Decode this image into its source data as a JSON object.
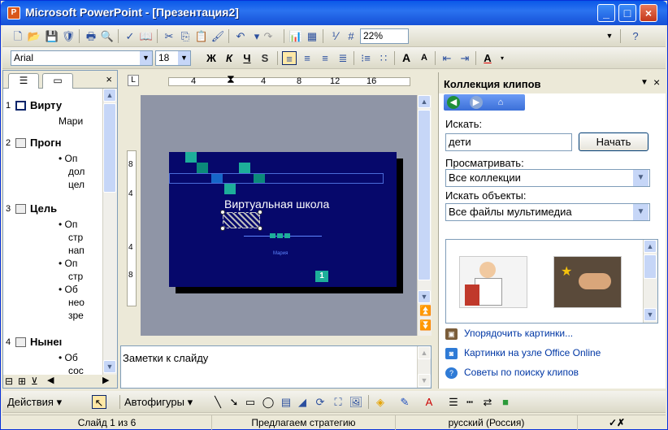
{
  "window": {
    "title": "Microsoft PowerPoint - [Презентация2]",
    "controls": [
      "minimize",
      "maximize",
      "close"
    ]
  },
  "standard_toolbar": {
    "zoom": "22%"
  },
  "format_toolbar": {
    "font": "Arial",
    "size": "18",
    "bold": "Ж",
    "italic": "К",
    "underline": "Ч",
    "shadow": "S",
    "grow_font": "A",
    "shrink_font": "A",
    "font_color": "A"
  },
  "outline": {
    "slides": [
      {
        "num": "1",
        "title": "Вирту",
        "lines": [
          "Мари"
        ]
      },
      {
        "num": "2",
        "title": "Прогн",
        "lines": [
          "• Оп",
          "дол",
          "цел"
        ]
      },
      {
        "num": "3",
        "title": "Цель",
        "lines": [
          "• Оп",
          "стр",
          "нап",
          "• Оп",
          "стр",
          "• Об",
          "нео",
          "зре"
        ]
      },
      {
        "num": "4",
        "title": "Нынеı",
        "lines": [
          "• Об",
          "сос"
        ]
      }
    ]
  },
  "ruler": {
    "top": [
      "4",
      "4",
      "8",
      "12",
      "16"
    ],
    "left": [
      "8",
      "4",
      "4",
      "8"
    ]
  },
  "slide": {
    "title": "Виртуальная школа",
    "subtitle": "Мария",
    "number": "1",
    "colors": {
      "background": "#06086b",
      "accent": "#1dae9a"
    }
  },
  "notes": {
    "placeholder": "Заметки к слайду"
  },
  "taskpane": {
    "title": "Коллекция клипов",
    "search_label": "Искать:",
    "search_value": "дети",
    "go_button": "Начать",
    "browse_label": "Просматривать:",
    "browse_value": "Все коллекции",
    "types_label": "Искать объекты:",
    "types_value": "Все файлы мультимедиа",
    "links": [
      "Упорядочить картинки...",
      "Картинки на узле Office Online",
      "Советы по поиску клипов"
    ]
  },
  "drawing_toolbar": {
    "actions": "Действия",
    "autoshapes": "Автофигуры"
  },
  "statusbar": {
    "slide": "Слайд 1 из 6",
    "design": "Предлагаем стратегию",
    "language": "русский (Россия)"
  }
}
